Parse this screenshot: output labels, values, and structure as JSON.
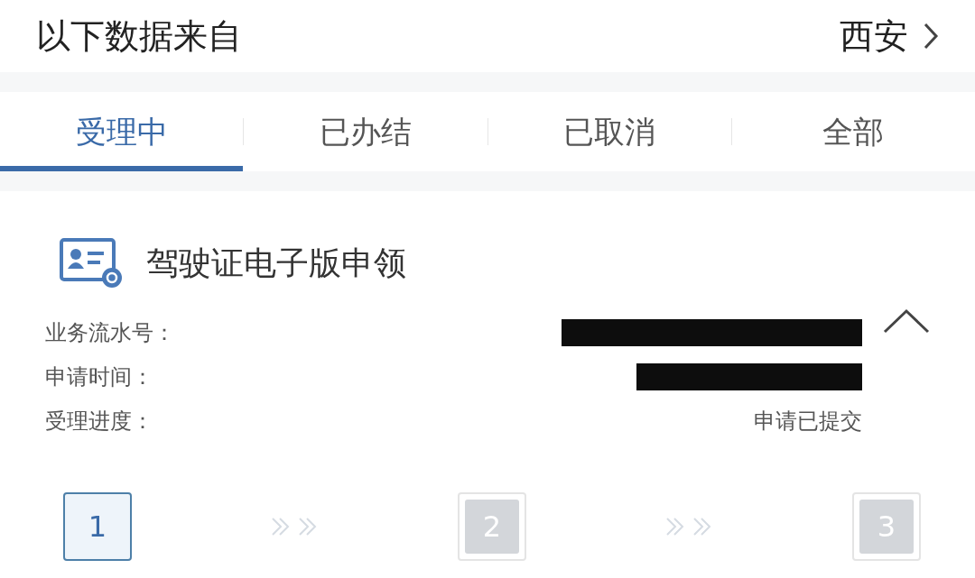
{
  "header": {
    "title": "以下数据来自",
    "city": "西安"
  },
  "tabs": [
    {
      "label": "受理中",
      "selected": true
    },
    {
      "label": "已办结",
      "selected": false
    },
    {
      "label": "已取消",
      "selected": false
    },
    {
      "label": "全部",
      "selected": false
    }
  ],
  "record": {
    "title": "驾驶证电子版申领",
    "expanded": true,
    "fields": [
      {
        "label": "业务流水号：",
        "redacted": true
      },
      {
        "label": "申请时间：",
        "redacted": true
      },
      {
        "label": "受理进度：",
        "value": "申请已提交",
        "redacted": false
      }
    ]
  },
  "steps": [
    {
      "number": "1",
      "selected": true
    },
    {
      "number": "2",
      "selected": false
    },
    {
      "number": "3",
      "selected": false
    }
  ]
}
